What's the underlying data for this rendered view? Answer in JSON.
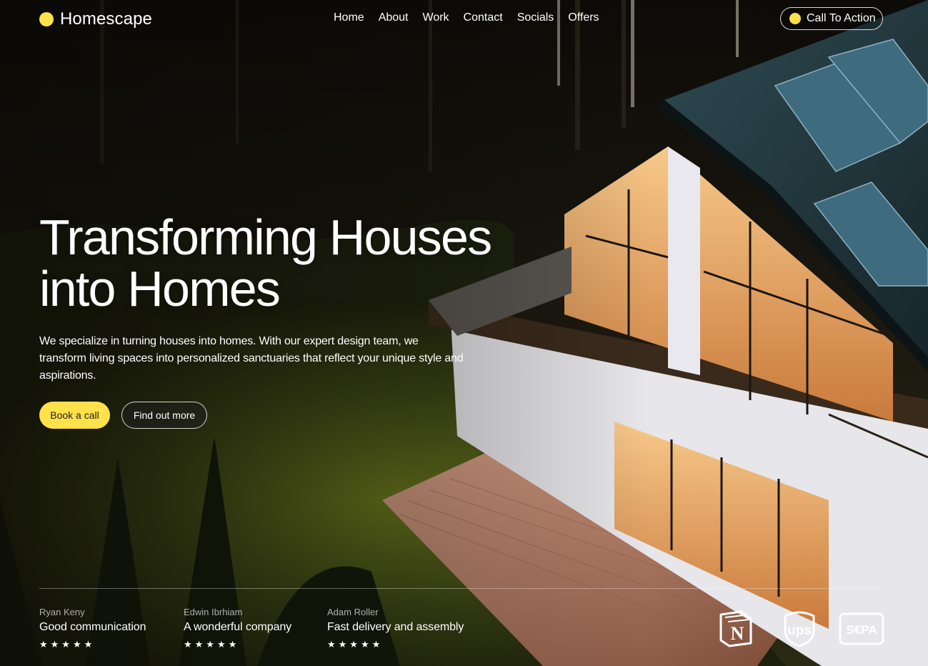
{
  "brand": {
    "name": "Homescape",
    "accent": "#ffe14a"
  },
  "nav": {
    "items": [
      "Home",
      "About",
      "Work",
      "Contact",
      "Socials",
      "Offers"
    ]
  },
  "cta": {
    "label": "Call To Action"
  },
  "hero": {
    "title_line1": "Transforming Houses",
    "title_line2": "into Homes",
    "description": "We specialize in turning houses into homes. With our expert design team, we transform living spaces into personalized sanctuaries that reflect your unique style and aspirations.",
    "primary_button": "Book a call",
    "secondary_button": "Find out more"
  },
  "reviews": [
    {
      "name": "Ryan Keny",
      "text": "Good communication",
      "stars": "★★★★★",
      "rating": 5
    },
    {
      "name": "Edwin Ibrhiam",
      "text": "A wonderful company",
      "stars": "★★★★★",
      "rating": 5
    },
    {
      "name": "Adam Roller",
      "text": "Fast delivery and assembly",
      "stars": "★★★★★",
      "rating": 5
    }
  ],
  "partners": [
    {
      "icon": "notion-logo",
      "text": "N"
    },
    {
      "icon": "ups-logo",
      "text": "ups"
    },
    {
      "icon": "sepa-logo",
      "text": "S€PA"
    }
  ],
  "colors": {
    "accent": "#ffe14a",
    "background": "#141008"
  }
}
